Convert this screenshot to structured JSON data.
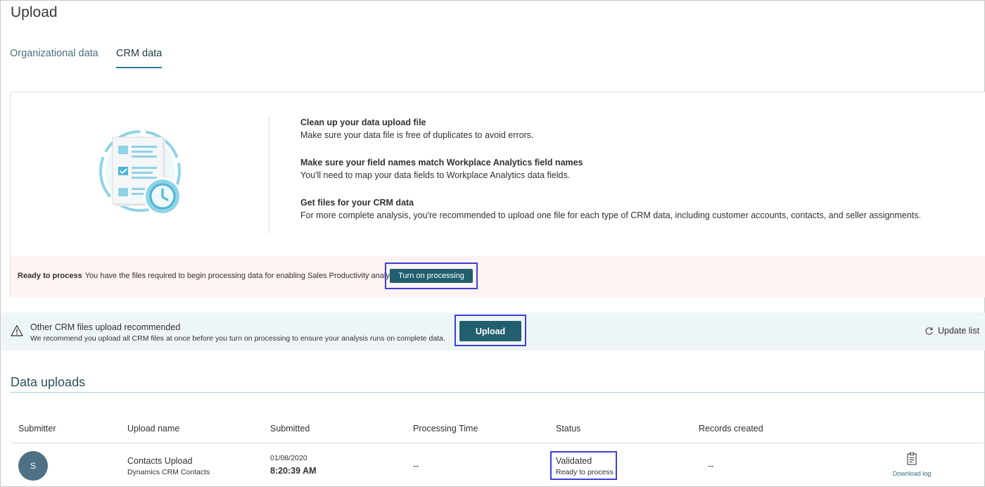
{
  "page": {
    "title": "Upload"
  },
  "tabs": [
    {
      "label": "Organizational data",
      "active": false
    },
    {
      "label": "CRM data",
      "active": true
    }
  ],
  "tips": [
    {
      "title": "Clean up your data upload file",
      "desc": "Make sure your data file is free of duplicates to avoid errors."
    },
    {
      "title": "Make sure your field names match Workplace Analytics field names",
      "desc": "You'll need to map your data fields to Workplace Analytics data fields."
    },
    {
      "title": "Get files for your CRM data",
      "desc": "For more complete analysis, you're recommended to upload one file for each type of CRM data, including customer accounts, contacts, and seller assignments."
    }
  ],
  "ready": {
    "label": "Ready to process",
    "text": "You have the files required to begin processing data for enabling Sales Productivity analysis.",
    "button": "Turn on processing"
  },
  "recommendation": {
    "title": "Other CRM files upload recommended",
    "desc": "We recommend you upload all CRM files at once before you turn on processing to ensure your analysis runs on complete data.",
    "button": "Upload",
    "update_list": "Update list"
  },
  "uploads": {
    "title": "Data uploads",
    "columns": [
      "Submitter",
      "Upload name",
      "Submitted",
      "Processing Time",
      "Status",
      "Records created"
    ],
    "rows": [
      {
        "avatar": "S",
        "upload_name": "Contacts Upload",
        "upload_type": "Dynamics CRM Contacts",
        "submitted_date": "01/08/2020",
        "submitted_time": "8:20:39 AM",
        "processing_time": "--",
        "status": "Validated",
        "status_sub": "Ready to process",
        "records_created": "--",
        "action": "Download log"
      }
    ]
  },
  "colors": {
    "accent": "#215e6e",
    "highlight": "#3f3fd9",
    "ready_bg": "#fdf3f2",
    "rec_bg": "#eef5f6"
  },
  "icons": [
    "checklist-clock-illustration",
    "warning-icon",
    "refresh-icon",
    "document-icon"
  ]
}
